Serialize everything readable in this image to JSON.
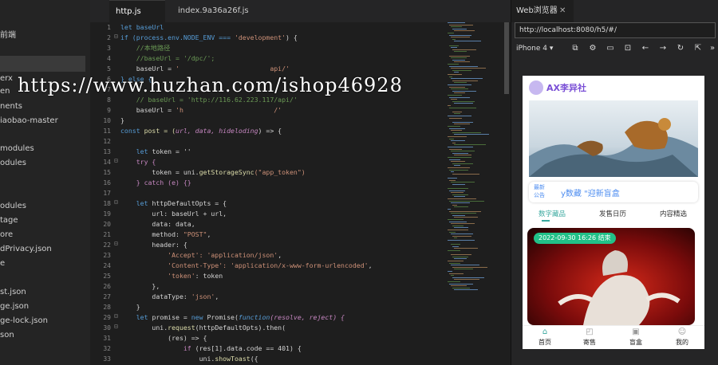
{
  "sidebar": {
    "items": [
      {
        "label": "前端"
      },
      {
        "label": "erx"
      },
      {
        "label": "en"
      },
      {
        "label": "nents"
      },
      {
        "label": "iaobao-master"
      },
      {
        "label": "modules"
      },
      {
        "label": "odules"
      },
      {
        "label": "odules"
      },
      {
        "label": "tage"
      },
      {
        "label": "ore"
      },
      {
        "label": "dPrivacy.json"
      },
      {
        "label": "e"
      },
      {
        "label": "st.json"
      },
      {
        "label": "ge.json"
      },
      {
        "label": "ge-lock.json"
      },
      {
        "label": "son"
      }
    ]
  },
  "editor": {
    "tabs": [
      {
        "label": "http.js"
      },
      {
        "label": "index.9a36a26f.js"
      }
    ],
    "line_numbers": [
      "1",
      "2",
      "3",
      "4",
      "5",
      "6",
      "7",
      "8",
      "9",
      "10",
      "11",
      "12",
      "13",
      "14",
      "15",
      "16",
      "17",
      "18",
      "19",
      "20",
      "21",
      "22",
      "23",
      "24",
      "25",
      "26",
      "27",
      "28",
      "29",
      "30",
      "31",
      "32",
      "33"
    ],
    "code": {
      "l1": "let baseUrl",
      "l2a": "if (process.env.NODE_ENV === ",
      "l2b": "'development'",
      "l2c": ") {",
      "l3": "    //本地路径",
      "l4": "    //baseUrl = '/dpc/';",
      "l5a": "    baseUrl = ",
      "l5b": "'                       api/'",
      "l6": "} else {",
      "l8": "    // baseUrl = 'http://116.62.223.117/api/'",
      "l9a": "    baseUrl = ",
      "l9b": "'h                       /'",
      "l10": "}",
      "l11a": "const ",
      "l11b": "post = (",
      "l11c": "url, data, hideloding",
      "l11d": ") => {",
      "l13a": "    let ",
      "l13b": "token = ''",
      "l14": "    try {",
      "l15a": "        token = uni.",
      "l15b": "getStorageSync",
      "l15c": "(\"app_token\")",
      "l16": "    } catch (e) {}",
      "l18a": "    let ",
      "l18b": "httpDefaultOpts = {",
      "l19": "        url: baseUrl + url,",
      "l20": "        data: data,",
      "l21a": "        method: ",
      "l21b": "\"POST\"",
      "l21c": ",",
      "l22": "        header: {",
      "l23a": "            ",
      "l23b": "'Accept': 'application/json'",
      "l23c": ",",
      "l24b": "'Content-Type': 'application/x-www-form-urlencoded'",
      "l25b": "'token'",
      "l25c": ": token",
      "l26": "        },",
      "l27a": "        dataType: ",
      "l27b": "'json'",
      "l27c": ",",
      "l28": "    }",
      "l29a": "    let ",
      "l29b": "promise = ",
      "l29c": "new ",
      "l29d": "Promise(",
      "l29e": "function",
      "l29f": "(resolve, reject) {",
      "l30a": "        uni.",
      "l30b": "request",
      "l30c": "(httpDefaultOpts).then(",
      "l31": "            (res) => {",
      "l32a": "                ",
      "l32b": "if ",
      "l32c": "(res[1].data.code == 401) {",
      "l33a": "                    uni.",
      "l33b": "showToast",
      "l33c": "({"
    }
  },
  "watermark": "https://www.huzhan.com/ishop46928",
  "browser": {
    "tab_label": "Web浏览器",
    "close_glyph": "✕",
    "url": "http://localhost:8080/h5/#/",
    "device": "iPhone 4",
    "icons": [
      "screenshot-icon",
      "settings-icon",
      "console-icon",
      "inspect-icon",
      "back-icon",
      "forward-icon",
      "refresh-icon",
      "pin-icon",
      "more-icon"
    ]
  },
  "phone": {
    "brand": "AX李异社",
    "notice_tag": "最新公告",
    "notice_text": "y数藏 \"迎新盲盒",
    "subtabs": [
      "数字藏品",
      "发售日历",
      "内容精选"
    ],
    "card_badge": "2022-09-30 16:26 结束",
    "nav": [
      {
        "label": "首页",
        "icon": "home-icon"
      },
      {
        "label": "寄售",
        "icon": "bag-icon"
      },
      {
        "label": "盲盒",
        "icon": "gift-icon"
      },
      {
        "label": "我的",
        "icon": "user-icon"
      }
    ]
  },
  "colors": {
    "accent_teal": "#3aa99f",
    "badge_green": "#22c088",
    "brand_purple": "#7a4fd6",
    "notice_blue": "#4c8cf0"
  }
}
